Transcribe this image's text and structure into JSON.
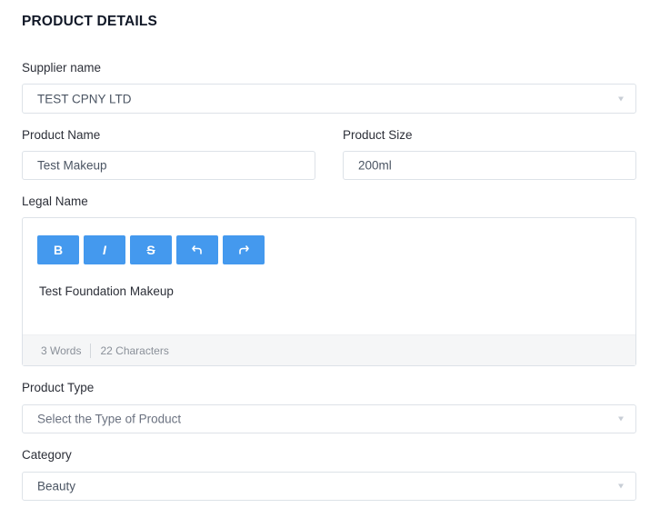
{
  "page_title": "PRODUCT DETAILS",
  "supplier": {
    "label": "Supplier name",
    "value": "TEST CPNY LTD"
  },
  "product_name": {
    "label": "Product Name",
    "value": "Test Makeup"
  },
  "product_size": {
    "label": "Product Size",
    "value": "200ml"
  },
  "legal_name": {
    "label": "Legal Name",
    "toolbar": {
      "bold": "B",
      "italic": "I",
      "strikethrough": "S",
      "undo": "undo-icon",
      "redo": "redo-icon"
    },
    "content": "Test Foundation Makeup",
    "word_count": "3 Words",
    "char_count": "22 Characters"
  },
  "product_type": {
    "label": "Product Type",
    "placeholder": "Select the Type of Product"
  },
  "category": {
    "label": "Category",
    "value": "Beauty"
  },
  "colors": {
    "accent": "#4499ee",
    "border": "#dde2e8",
    "footer_bg": "#f5f6f7"
  }
}
